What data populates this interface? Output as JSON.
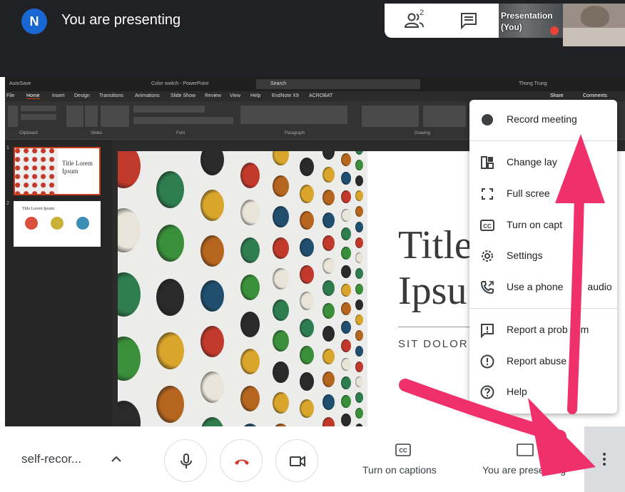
{
  "header": {
    "avatar_letter": "N",
    "title": "You are presenting",
    "people_count": "2",
    "presentation_tile_label_line1": "Presentation",
    "presentation_tile_label_line2": "(You)"
  },
  "ppt": {
    "autosave": "AutoSave",
    "doc_title": "Color switch - PowerPoint",
    "search": "Search",
    "user": "Thong Trung",
    "menu": [
      "File",
      "Home",
      "Insert",
      "Design",
      "Transitions",
      "Animations",
      "Slide Show",
      "Review",
      "View",
      "Help",
      "EndNote X9",
      "ACROBAT"
    ],
    "share": "Share",
    "comments": "Comments",
    "groups": [
      "Clipboard",
      "Slides",
      "Font",
      "Paragraph",
      "Drawing"
    ],
    "thumb1_title": "Title Lorem Ipsum",
    "thumb2_title": "Title Lorem Ipsum",
    "slide_numbers": [
      "1",
      "2"
    ],
    "slide_title_line1": "Title",
    "slide_title_line2": "Ipsu",
    "slide_subtitle": "SIT DOLOR A"
  },
  "menu": {
    "items": [
      {
        "label": "Record meeting",
        "icon": "record-dot-icon"
      },
      {
        "label": "Change lay",
        "icon": "layout-icon"
      },
      {
        "label": "Full scree",
        "icon": "fullscreen-icon"
      },
      {
        "label": "Turn on capt",
        "icon": "captions-icon"
      },
      {
        "label": "Settings",
        "icon": "gear-icon"
      },
      {
        "label": "Use a phone",
        "label_tail": "audio",
        "icon": "phone-icon"
      },
      {
        "label": "Report a prob",
        "label_tail": "m",
        "icon": "report-problem-icon"
      },
      {
        "label": "Report abuse",
        "icon": "report-abuse-icon"
      },
      {
        "label": "Help",
        "icon": "help-icon"
      }
    ]
  },
  "bottom": {
    "meeting_name": "self-recor...",
    "captions_label": "Turn on captions",
    "presenting_label": "You are presenting"
  },
  "colors": {
    "accent_red": "#ea4335",
    "arrow_pink": "#f0306a",
    "meet_blue": "#1967d2"
  }
}
